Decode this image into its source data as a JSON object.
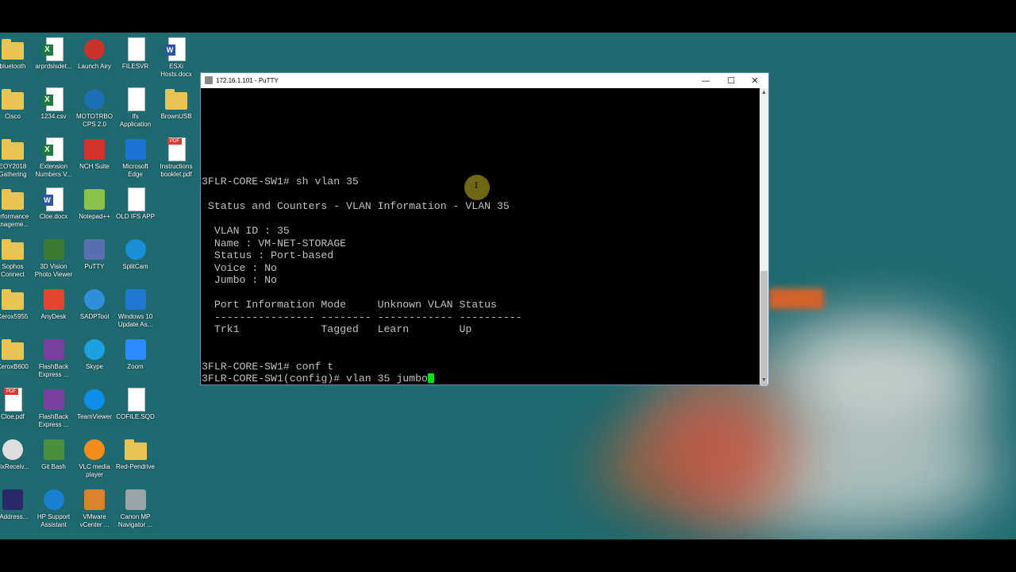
{
  "desktop_icons": [
    {
      "label": "bluetooth",
      "kind": "folder"
    },
    {
      "label": "arprdslsdet...",
      "kind": "excel"
    },
    {
      "label": "Launch Airy",
      "kind": "round",
      "color": "#c8332c"
    },
    {
      "label": "FILESVR",
      "kind": "doc"
    },
    {
      "label": "ESXi\nHosts.docx",
      "kind": "word"
    },
    {
      "label": "Cisco",
      "kind": "folder"
    },
    {
      "label": "1234.csv",
      "kind": "excel"
    },
    {
      "label": "MOTOTRBO\nCPS 2.0",
      "kind": "round",
      "color": "#1f6fb5"
    },
    {
      "label": "Ifs\nApplication",
      "kind": "doc"
    },
    {
      "label": "BrownUSB",
      "kind": "folder"
    },
    {
      "label": "EOY2018\nGathering",
      "kind": "folder"
    },
    {
      "label": "Extension\nNumbers V...",
      "kind": "excel"
    },
    {
      "label": "NCH Suite",
      "kind": "square",
      "color": "#d2332c"
    },
    {
      "label": "Microsoft\nEdge",
      "kind": "square",
      "color": "#1b74d4"
    },
    {
      "label": "Instructions\nbooklet.pdf",
      "kind": "pdf"
    },
    {
      "label": "erformance\nanageme...",
      "kind": "folder"
    },
    {
      "label": "Cloe.docx",
      "kind": "word"
    },
    {
      "label": "Notepad++",
      "kind": "square",
      "color": "#8bc34a"
    },
    {
      "label": "OLD IFS APP",
      "kind": "doc"
    },
    {
      "label": "",
      "kind": "none"
    },
    {
      "label": "Sophos\nConnect",
      "kind": "folder"
    },
    {
      "label": "3D Vision\nPhoto Viewer",
      "kind": "square",
      "color": "#3b7a33"
    },
    {
      "label": "PuTTY",
      "kind": "square",
      "color": "#5a6fb0"
    },
    {
      "label": "SplitCam",
      "kind": "round",
      "color": "#1a8fd8"
    },
    {
      "label": "",
      "kind": "none"
    },
    {
      "label": "Xerox5955",
      "kind": "folder"
    },
    {
      "label": "AnyDesk",
      "kind": "square",
      "color": "#e1462f"
    },
    {
      "label": "SADPTool",
      "kind": "round",
      "color": "#2f8fd8"
    },
    {
      "label": "Windows 10\nUpdate As...",
      "kind": "square",
      "color": "#1f78d0"
    },
    {
      "label": "",
      "kind": "none"
    },
    {
      "label": "XeroxB600",
      "kind": "folder"
    },
    {
      "label": "FlashBack\nExpress ...",
      "kind": "square",
      "color": "#7b3fa0"
    },
    {
      "label": "Skype",
      "kind": "round",
      "color": "#1ba1e2"
    },
    {
      "label": "Zoom",
      "kind": "square",
      "color": "#2d8cff"
    },
    {
      "label": "",
      "kind": "none"
    },
    {
      "label": "Cloe.pdf",
      "kind": "pdf"
    },
    {
      "label": "FlashBack\nExpress ...",
      "kind": "square",
      "color": "#7b3fa0"
    },
    {
      "label": "TeamViewer",
      "kind": "round",
      "color": "#0e8ee9"
    },
    {
      "label": "COFILE.SQD",
      "kind": "doc"
    },
    {
      "label": "",
      "kind": "none"
    },
    {
      "label": "trixReceiv...",
      "kind": "round",
      "color": "#dddddd"
    },
    {
      "label": "Git Bash",
      "kind": "square",
      "color": "#4a8f3d"
    },
    {
      "label": "VLC media\nplayer",
      "kind": "round",
      "color": "#f28c1c"
    },
    {
      "label": "Red-Pendrive",
      "kind": "folder"
    },
    {
      "label": "",
      "kind": "none"
    },
    {
      "label": "-Address...",
      "kind": "square",
      "color": "#2a2a6a"
    },
    {
      "label": "HP Support\nAssistant",
      "kind": "round",
      "color": "#1a7fd0"
    },
    {
      "label": "VMware\nvCenter ...",
      "kind": "square",
      "color": "#d9822b"
    },
    {
      "label": "Canon MP\nNavigator ...",
      "kind": "square",
      "color": "#9aa3a8"
    },
    {
      "label": "",
      "kind": "none"
    }
  ],
  "putty": {
    "title": "172.16.1.101 - PuTTY",
    "min_glyph": "—",
    "max_glyph": "☐",
    "close_glyph": "✕",
    "scroll_up": "▲",
    "scroll_down": "▼",
    "lines": [
      "3FLR-CORE-SW1# sh vlan 35",
      "",
      " Status and Counters - VLAN Information - VLAN 35",
      "",
      "  VLAN ID : 35",
      "  Name : VM-NET-STORAGE",
      "  Status : Port-based",
      "  Voice : No",
      "  Jumbo : No",
      "",
      "  Port Information Mode     Unknown VLAN Status",
      "  ---------------- -------- ------------ ----------",
      "  Trk1             Tagged   Learn        Up",
      "",
      "",
      "3FLR-CORE-SW1# conf t",
      "3FLR-CORE-SW1(config)# vlan 35 jumbo"
    ]
  }
}
